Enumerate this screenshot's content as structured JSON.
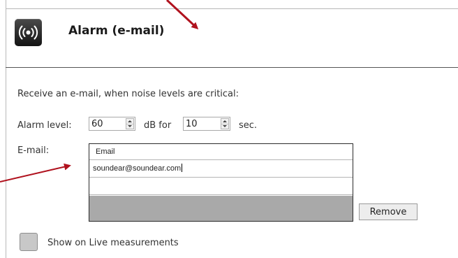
{
  "header": {
    "title": "Alarm (e-mail)",
    "icon": "broadcast-icon"
  },
  "description": "Receive an e-mail, when noise levels are critical:",
  "alarm": {
    "label": "Alarm level:",
    "level_value": "60",
    "db_for_label": "dB for",
    "duration_value": "10",
    "sec_label": "sec."
  },
  "email": {
    "label": "E-mail:",
    "column_header": "Email",
    "rows": [
      "soundear@soundear.com",
      ""
    ],
    "remove_label": "Remove"
  },
  "show_live": {
    "label": "Show on Live measurements",
    "checked": false
  },
  "annotation_color": "#b0121e"
}
